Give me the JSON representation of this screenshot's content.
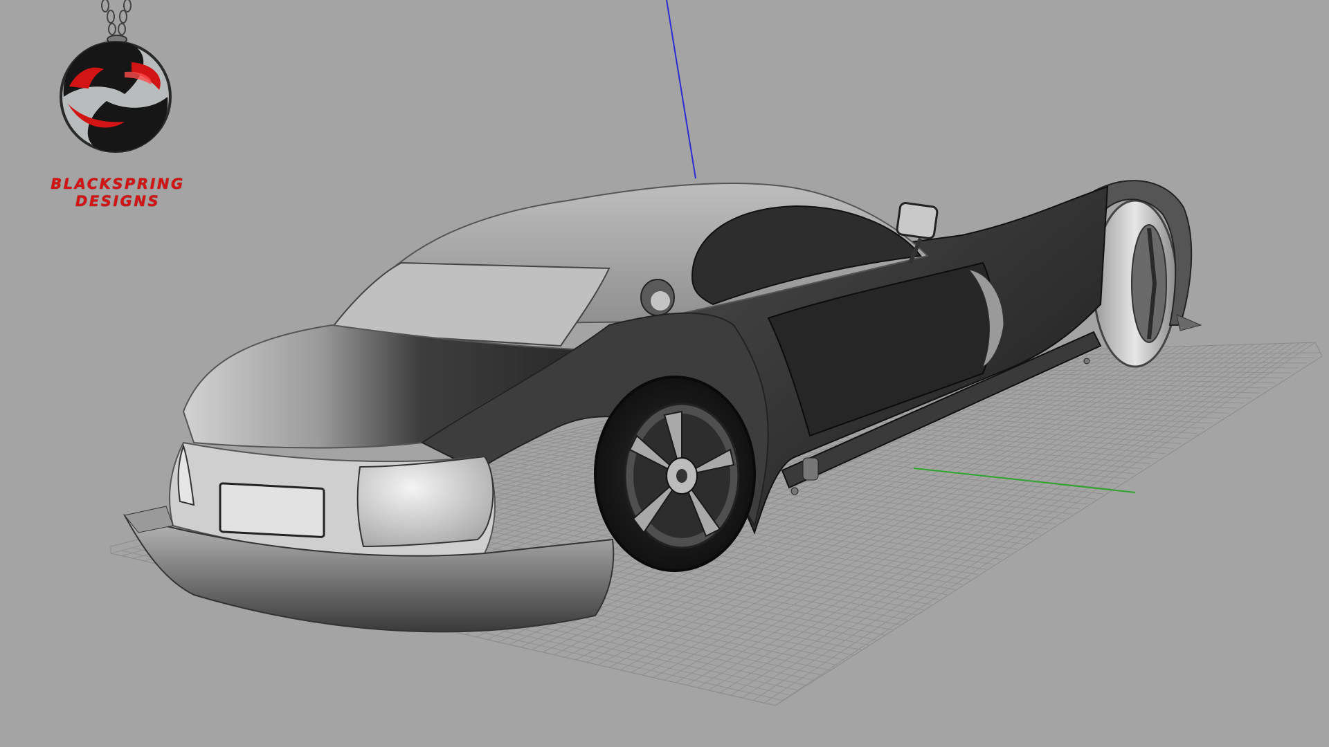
{
  "viewport": {
    "background_color": "#a4a4a4",
    "grid_color": "#8e8e8e",
    "axis_colors": {
      "x_axis": "#2ea52e",
      "z_axis": "#2b2bd6"
    },
    "object": "car-body-render",
    "shading": "grayscale"
  },
  "logo": {
    "icon": "s-emblem-icon",
    "colors": {
      "primary": "#161616",
      "accent": "#d21414",
      "secondary": "#b9bcbd"
    },
    "line1": "BLACKSPRING",
    "line2": "DESIGNS"
  }
}
